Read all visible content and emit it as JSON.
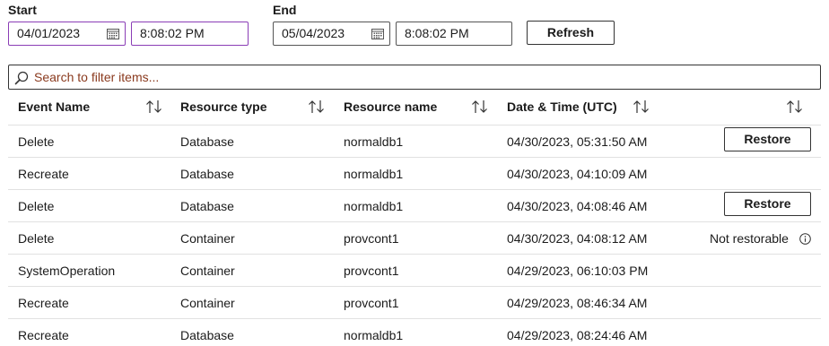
{
  "filters": {
    "start_label": "Start",
    "start_date": "04/01/2023",
    "start_time": "8:08:02 PM",
    "end_label": "End",
    "end_date": "05/04/2023",
    "end_time": "8:08:02 PM",
    "refresh_label": "Refresh"
  },
  "search": {
    "placeholder": "Search to filter items..."
  },
  "table": {
    "columns": [
      "Event Name",
      "Resource type",
      "Resource name",
      "Date & Time (UTC)"
    ],
    "rows": [
      {
        "event": "Delete",
        "type": "Database",
        "name": "normaldb1",
        "datetime": "04/30/2023, 05:31:50 AM",
        "action": "Restore"
      },
      {
        "event": "Recreate",
        "type": "Database",
        "name": "normaldb1",
        "datetime": "04/30/2023, 04:10:09 AM",
        "action": ""
      },
      {
        "event": "Delete",
        "type": "Database",
        "name": "normaldb1",
        "datetime": "04/30/2023, 04:08:46 AM",
        "action": "Restore"
      },
      {
        "event": "Delete",
        "type": "Container",
        "name": "provcont1",
        "datetime": "04/30/2023, 04:08:12 AM",
        "action": "",
        "status": "Not restorable"
      },
      {
        "event": "SystemOperation",
        "type": "Container",
        "name": "provcont1",
        "datetime": "04/29/2023, 06:10:03 PM",
        "action": ""
      },
      {
        "event": "Recreate",
        "type": "Container",
        "name": "provcont1",
        "datetime": "04/29/2023, 08:46:34 AM",
        "action": ""
      },
      {
        "event": "Recreate",
        "type": "Database",
        "name": "normaldb1",
        "datetime": "04/29/2023, 08:24:46 AM",
        "action": ""
      }
    ]
  },
  "icons": {
    "calendar": "calendar-icon",
    "search": "search-icon",
    "sort": "sort-icon",
    "info": "info-icon"
  },
  "colors": {
    "active_border": "#8a3db6",
    "placeholder": "#8a3a1e"
  }
}
